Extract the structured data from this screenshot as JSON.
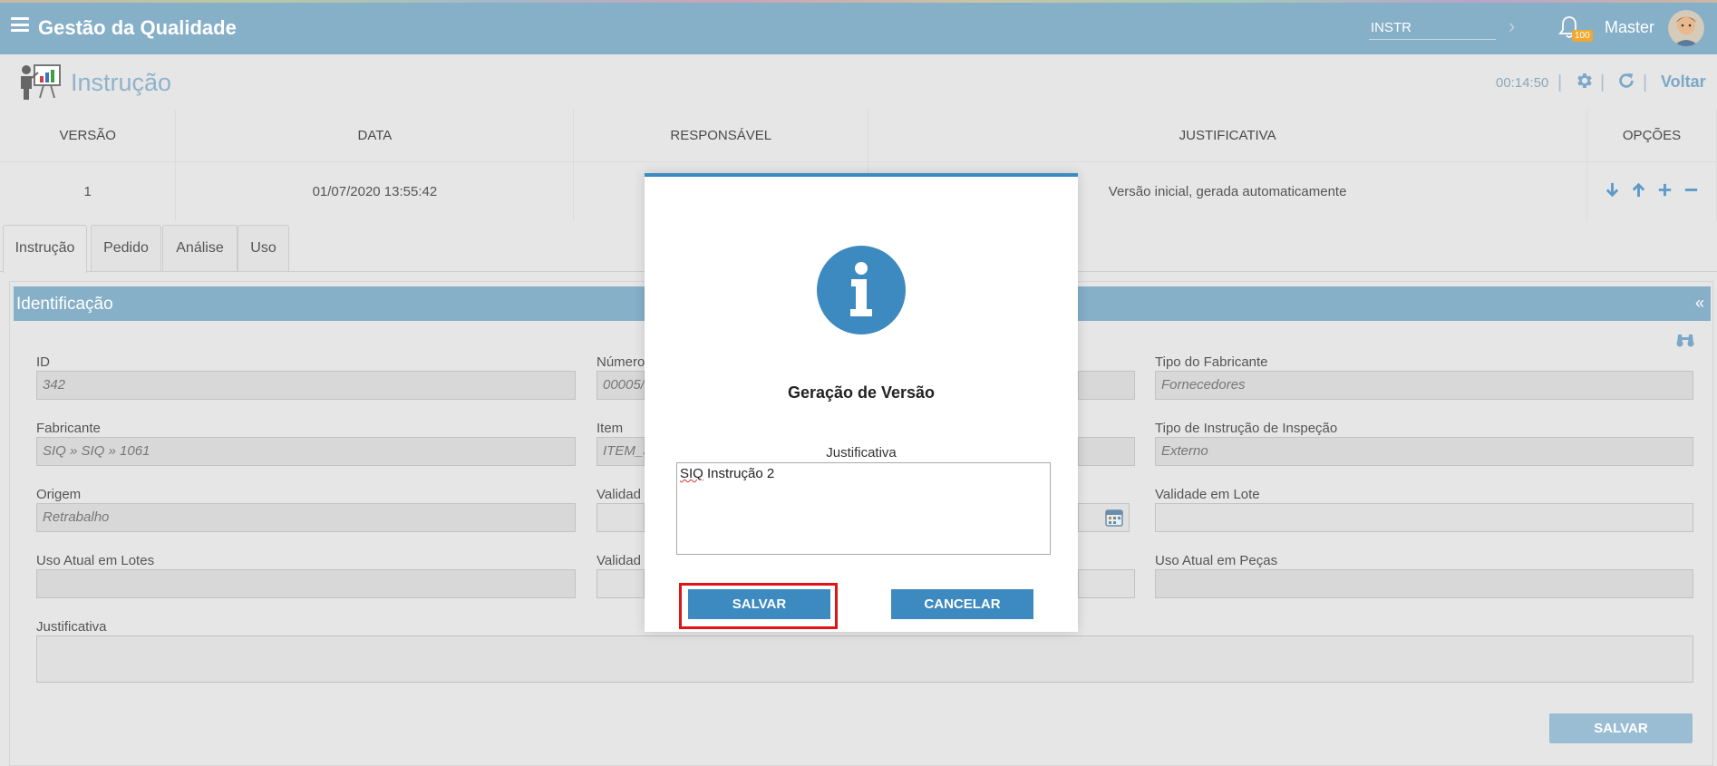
{
  "header": {
    "app_title": "Gestão da Qualidade",
    "search_value": "INSTR",
    "notifications_count": "100",
    "user_name": "Master"
  },
  "page": {
    "title": "Instrução",
    "timer": "00:14:50",
    "back_label": "Voltar"
  },
  "versions_table": {
    "columns": [
      "VERSÃO",
      "DATA",
      "RESPONSÁVEL",
      "JUSTIFICATIVA",
      "OPÇÕES"
    ],
    "rows": [
      {
        "version": "1",
        "date": "01/07/2020 13:55:42",
        "responsible": "",
        "justification": "Versão inicial, gerada automaticamente"
      }
    ]
  },
  "tabs": [
    "Instrução",
    "Pedido",
    "Análise",
    "Uso"
  ],
  "panel": {
    "title": "Identificação",
    "collapse_glyph": "«",
    "fields": {
      "id_label": "ID",
      "id_value": "342",
      "numero_label": "Número",
      "numero_value": "00005/",
      "tipo_fabricante_label": "Tipo do Fabricante",
      "tipo_fabricante_value": "Fornecedores",
      "fabricante_label": "Fabricante",
      "fabricante_value": "SIQ  »  SIQ  » 1061",
      "item_label": "Item",
      "item_value": "ITEM_S",
      "tipo_instrucao_label": "Tipo de Instrução de Inspeção",
      "tipo_instrucao_value": "Externo",
      "origem_label": "Origem",
      "origem_value": "Retrabalho",
      "validade_label": "Validad",
      "validade_lote_label": "Validade em Lote",
      "uso_lotes_label": "Uso Atual em Lotes",
      "validade2_label": "Validad",
      "uso_pecas_label": "Uso Atual em Peças",
      "justificativa_label": "Justificativa"
    },
    "save_label": "SALVAR"
  },
  "modal": {
    "title": "Geração de Versão",
    "field_label": "Justificativa",
    "text_prefix": "SIQ",
    "text_rest": " Instrução 2",
    "save_label": "SALVAR",
    "cancel_label": "CANCELAR"
  },
  "colors": {
    "header_bg": "#86afc8",
    "primary_button": "#3c8ac0",
    "highlight": "#e01414"
  }
}
